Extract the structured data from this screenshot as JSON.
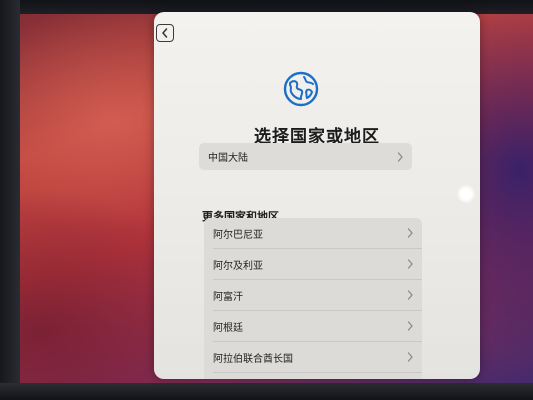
{
  "sheet": {
    "back_label": "Back",
    "title": "选择国家或地区",
    "featured": {
      "label": "中国大陆"
    },
    "section_header": "更多国家和地区",
    "countries": [
      {
        "label": "阿尔巴尼亚"
      },
      {
        "label": "阿尔及利亚"
      },
      {
        "label": "阿富汗"
      },
      {
        "label": "阿根廷"
      },
      {
        "label": "阿拉伯联合酋长国"
      }
    ]
  },
  "icons": {
    "back": "chevron-left-icon",
    "globe": "globe-icon",
    "row_disclosure": "chevron-right-icon"
  },
  "colors": {
    "accent_blue": "#1c6fc4",
    "sheet_background": "#efeeea",
    "row_background": "#dddcd8"
  }
}
